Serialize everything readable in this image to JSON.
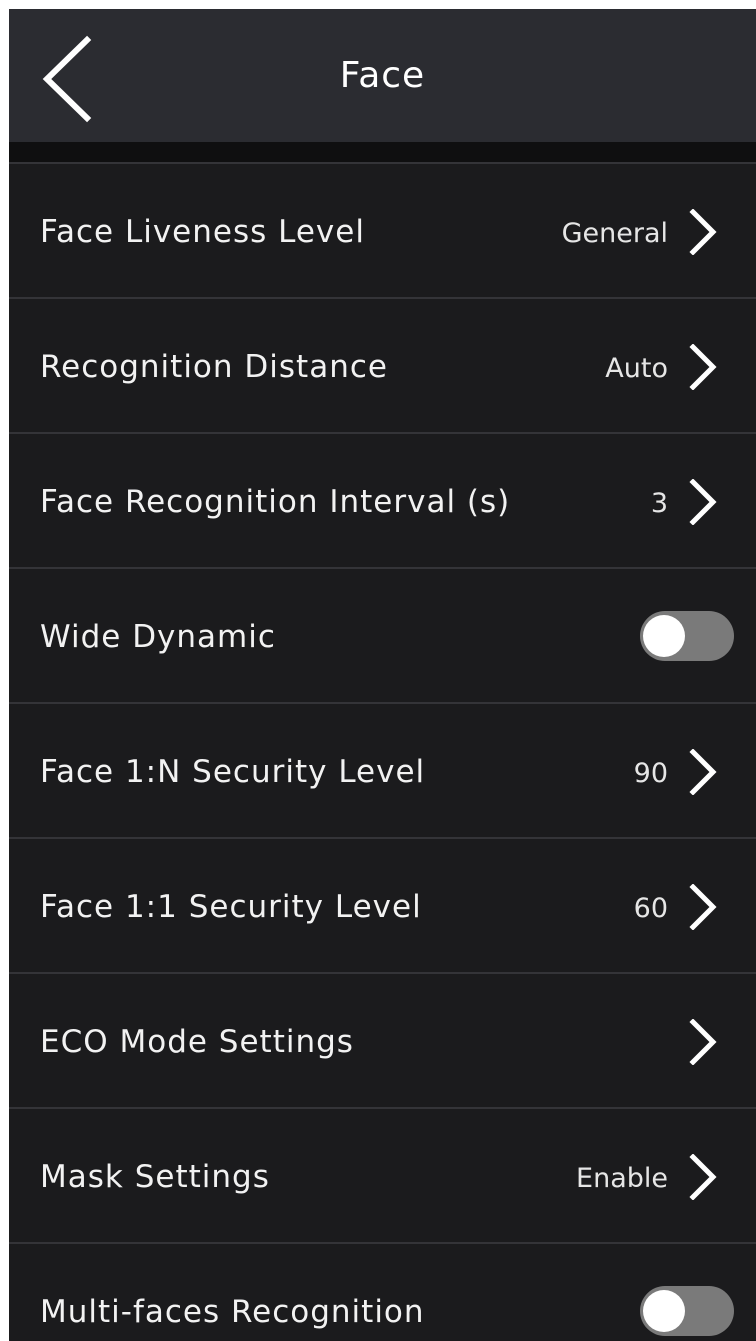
{
  "header": {
    "title": "Face",
    "back_icon": "chevron-left-icon"
  },
  "settings": [
    {
      "label": "Face Liveness Level",
      "value": "General",
      "control": "chevron"
    },
    {
      "label": "Recognition Distance",
      "value": "Auto",
      "control": "chevron"
    },
    {
      "label": "Face Recognition Interval (s)",
      "value": "3",
      "control": "chevron"
    },
    {
      "label": "Wide Dynamic",
      "value": "",
      "control": "toggle",
      "enabled": false
    },
    {
      "label": "Face 1:N Security Level",
      "value": "90",
      "control": "chevron"
    },
    {
      "label": "Face 1:1 Security Level",
      "value": "60",
      "control": "chevron"
    },
    {
      "label": "ECO Mode Settings",
      "value": "",
      "control": "chevron"
    },
    {
      "label": "Mask Settings",
      "value": "Enable",
      "control": "chevron"
    },
    {
      "label": "Multi-faces Recognition",
      "value": "",
      "control": "toggle",
      "enabled": false
    }
  ],
  "colors": {
    "background": "#1b1b1d",
    "header": "#2b2c31",
    "divider": "#343438",
    "text": "#f2f2f2",
    "toggle_off_track": "#7a7a7a",
    "toggle_knob": "#ffffff"
  }
}
